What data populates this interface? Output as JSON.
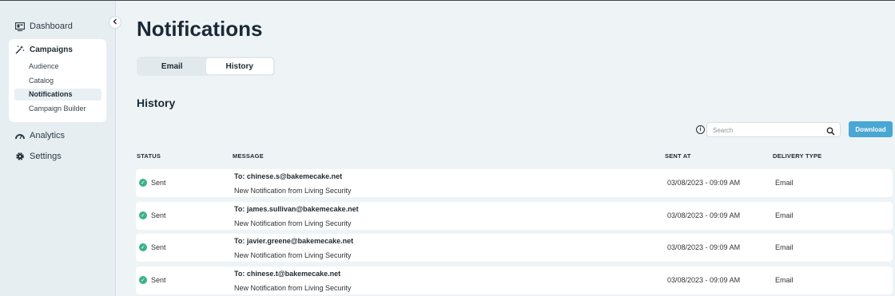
{
  "sidebar": {
    "dashboard": "Dashboard",
    "campaigns": {
      "label": "Campaigns",
      "items": [
        "Audience",
        "Catalog",
        "Notifications",
        "Campaign Builder"
      ],
      "active_index": 2
    },
    "analytics": "Analytics",
    "settings": "Settings"
  },
  "main": {
    "title": "Notifications",
    "tabs": [
      "Email",
      "History"
    ],
    "active_tab": "History",
    "section_title": "History",
    "search": {
      "placeholder": "Search",
      "value": ""
    },
    "download_label": "Download",
    "columns": [
      "STATUS",
      "MESSAGE",
      "SENT AT",
      "DELIVERY TYPE"
    ],
    "rows": [
      {
        "status": "Sent",
        "to": "To: chinese.s@bakemecake.net",
        "message": "New Notification from Living Security",
        "sent_at": "03/08/2023 - 09:09 AM",
        "delivery_type": "Email"
      },
      {
        "status": "Sent",
        "to": "To: james.sullivan@bakemecake.net",
        "message": "New Notification from Living Security",
        "sent_at": "03/08/2023 - 09:09 AM",
        "delivery_type": "Email"
      },
      {
        "status": "Sent",
        "to": "To: javier.greene@bakemecake.net",
        "message": "New Notification from Living Security",
        "sent_at": "03/08/2023 - 09:09 AM",
        "delivery_type": "Email"
      },
      {
        "status": "Sent",
        "to": "To: chinese.t@bakemecake.net",
        "message": "New Notification from Living Security",
        "sent_at": "03/08/2023 - 09:09 AM",
        "delivery_type": "Email"
      }
    ]
  },
  "colors": {
    "accent": "#4aa7d4",
    "success": "#3bb08f",
    "background": "#eef3f6",
    "sidebar": "#e6eef2"
  }
}
